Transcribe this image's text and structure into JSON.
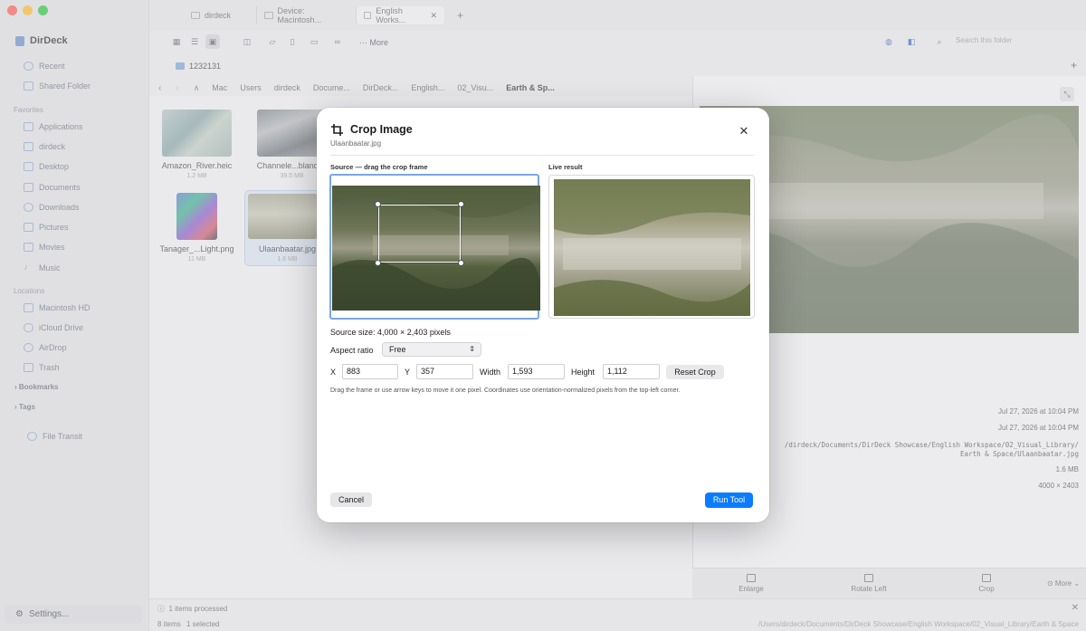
{
  "app": {
    "name": "DirDeck",
    "tabs": [
      {
        "label": "dirdeck"
      },
      {
        "label": "Device: Macintosh..."
      },
      {
        "label": "English Works..."
      }
    ],
    "toolbar": {
      "more_label": "More",
      "search_placeholder": "Search this folder"
    },
    "path_folder": "1232131",
    "breadcrumbs": [
      "Mac",
      "Users",
      "dirdeck",
      "Docume...",
      "DirDeck...",
      "English...",
      "02_Visu...",
      "Earth & Sp..."
    ]
  },
  "sidebar": {
    "recent": "Recent",
    "shared": "Shared Folder",
    "favorites_head": "Favorites",
    "favorites": [
      "Applications",
      "dirdeck",
      "Desktop",
      "Documents",
      "Downloads",
      "Pictures",
      "Movies",
      "Music"
    ],
    "locations_head": "Locations",
    "locations": [
      "Macintosh HD",
      "iCloud Drive",
      "AirDrop",
      "Trash"
    ],
    "bookmarks": "Bookmarks",
    "tags": "Tags",
    "file_transit": "File Transit",
    "settings": "Settings..."
  },
  "files": [
    {
      "name": "Amazon_River.heic",
      "size": "1.2 MB"
    },
    {
      "name": "Channele...blands.t",
      "size": "39.5 MB"
    },
    {
      "name": "Tanager_...Light.png",
      "size": "11 MB"
    },
    {
      "name": "Ulaanbaatar.jpg",
      "size": "1.6 MB"
    }
  ],
  "preview": {
    "created": "Jul 27, 2026 at 10:04 PM",
    "modified": "Jul 27, 2026 at 10:04 PM",
    "path_line1": "/dirdeck/Documents/DirDeck Showcase/English Workspace/02_Visual_Library/",
    "path_line2": "Earth & Space/Ulaanbaatar.jpg",
    "size": "1.6 MB",
    "dimensions": "4000 × 2403",
    "actions": [
      "Enlarge",
      "Rotate Left",
      "Crop",
      "More"
    ]
  },
  "status": {
    "processed": "1 items processed",
    "items": "8 items",
    "selected": "1 selected",
    "path": "/Users/dirdeck/Documents/DirDeck Showcase/English Workspace/02_Visual_Library/Earth & Space"
  },
  "modal": {
    "title": "Crop Image",
    "subtitle": "Ulaanbaatar.jpg",
    "source_label": "Source — drag the crop frame",
    "result_label": "Live result",
    "source_size": "Source size: 4,000 × 2,403 pixels",
    "aspect_label": "Aspect ratio",
    "aspect_value": "Free",
    "x_label": "X",
    "x_value": "883",
    "y_label": "Y",
    "y_value": "357",
    "width_label": "Width",
    "width_value": "1,593",
    "height_label": "Height",
    "height_value": "1,112",
    "reset_label": "Reset Crop",
    "hint": "Drag the frame or use arrow keys to move it one pixel. Coordinates use orientation-normalized pixels from the top-left corner.",
    "cancel_label": "Cancel",
    "run_label": "Run Tool"
  },
  "colors": {
    "accent": "#0a7cff",
    "frame": "#7aa6e6"
  }
}
